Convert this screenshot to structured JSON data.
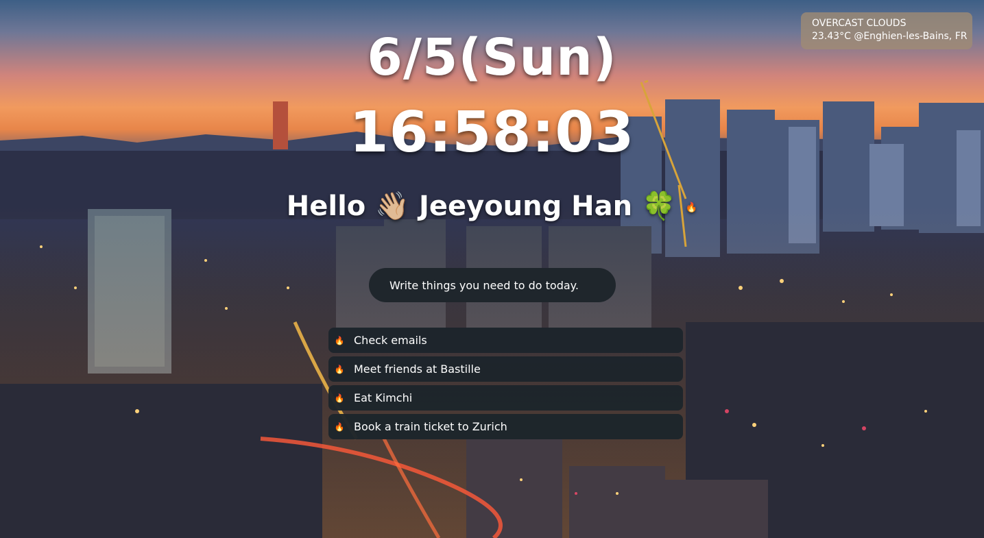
{
  "weather": {
    "condition": "OVERCAST CLOUDS",
    "temperature": "23.43°C",
    "location": "@Enghien-les-Bains, FR"
  },
  "clock": {
    "date": "6/5(Sun)",
    "time": "16:58:03"
  },
  "greeting": {
    "hello": "Hello",
    "wave_emoji": "👋🏼",
    "name": "Jeeyoung Han",
    "clover_emoji": "🍀",
    "fire_emoji": "🔥"
  },
  "todo": {
    "placeholder": "Write things you need to do today.",
    "items": [
      {
        "icon": "🔥",
        "text": "Check emails"
      },
      {
        "icon": "🔥",
        "text": "Meet friends at Bastille"
      },
      {
        "icon": "🔥",
        "text": "Eat Kimchi"
      },
      {
        "icon": "🔥",
        "text": "Book a train ticket to Zurich"
      }
    ]
  }
}
